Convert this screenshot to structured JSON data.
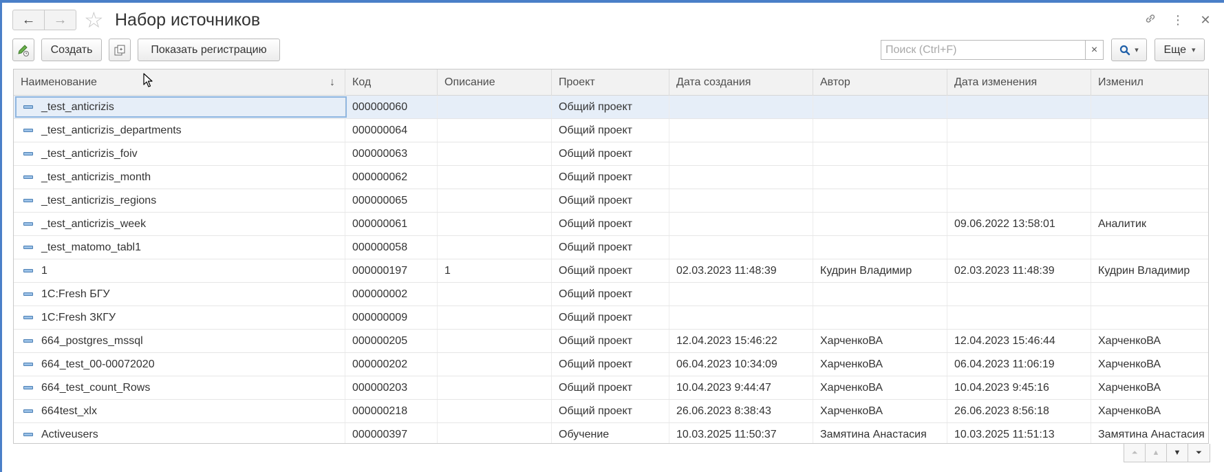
{
  "window": {
    "title": "Набор источников",
    "back_icon": "←",
    "forward_icon": "→",
    "star_icon": "☆",
    "link_icon": "🔗",
    "more_icon": "⋮",
    "close_icon": "✕"
  },
  "toolbar": {
    "create_label": "Создать",
    "show_registration_label": "Показать регистрацию",
    "search_placeholder": "Поиск (Ctrl+F)",
    "search_clear": "×",
    "search_dropdown": "▾",
    "more_label": "Еще",
    "more_dropdown": "▾"
  },
  "table": {
    "columns": [
      "Наименование",
      "Код",
      "Описание",
      "Проект",
      "Дата создания",
      "Автор",
      "Дата изменения",
      "Изменил"
    ],
    "sort_indicator": "↓",
    "rows": [
      [
        "_test_anticrizis",
        "000000060",
        "",
        "Общий проект",
        "",
        "",
        "",
        ""
      ],
      [
        "_test_anticrizis_departments",
        "000000064",
        "",
        "Общий проект",
        "",
        "",
        "",
        ""
      ],
      [
        "_test_anticrizis_foiv",
        "000000063",
        "",
        "Общий проект",
        "",
        "",
        "",
        ""
      ],
      [
        "_test_anticrizis_month",
        "000000062",
        "",
        "Общий проект",
        "",
        "",
        "",
        ""
      ],
      [
        "_test_anticrizis_regions",
        "000000065",
        "",
        "Общий проект",
        "",
        "",
        "",
        ""
      ],
      [
        "_test_anticrizis_week",
        "000000061",
        "",
        "Общий проект",
        "",
        "",
        "09.06.2022 13:58:01",
        "Аналитик"
      ],
      [
        "_test_matomo_tabl1",
        "000000058",
        "",
        "Общий проект",
        "",
        "",
        "",
        ""
      ],
      [
        "1",
        "000000197",
        "1",
        "Общий проект",
        "02.03.2023 11:48:39",
        "Кудрин Владимир",
        "02.03.2023 11:48:39",
        "Кудрин Владимир"
      ],
      [
        "1C:Fresh БГУ",
        "000000002",
        "",
        "Общий проект",
        "",
        "",
        "",
        ""
      ],
      [
        "1C:Fresh ЗКГУ",
        "000000009",
        "",
        "Общий проект",
        "",
        "",
        "",
        ""
      ],
      [
        "664_postgres_mssql",
        "000000205",
        "",
        "Общий проект",
        "12.04.2023 15:46:22",
        "ХарченкоВА",
        "12.04.2023 15:46:44",
        "ХарченкоВА"
      ],
      [
        "664_test_00-00072020",
        "000000202",
        "",
        "Общий проект",
        "06.04.2023 10:34:09",
        "ХарченкоВА",
        "06.04.2023 11:06:19",
        "ХарченкоВА"
      ],
      [
        "664_test_count_Rows",
        "000000203",
        "",
        "Общий проект",
        "10.04.2023 9:44:47",
        "ХарченкоВА",
        "10.04.2023 9:45:16",
        "ХарченкоВА"
      ],
      [
        "664test_xlx",
        "000000218",
        "",
        "Общий проект",
        "26.06.2023 8:38:43",
        "ХарченкоВА",
        "26.06.2023 8:56:18",
        "ХарченкоВА"
      ],
      [
        "Activeusers",
        "000000397",
        "",
        "Обучение",
        "10.03.2025 11:50:37",
        "Замятина Анастасия",
        "10.03.2025 11:51:13",
        "Замятина Анастасия"
      ]
    ]
  },
  "scroll": {
    "first": "⏶",
    "up": "▲",
    "down": "▼",
    "last": "⏷"
  }
}
